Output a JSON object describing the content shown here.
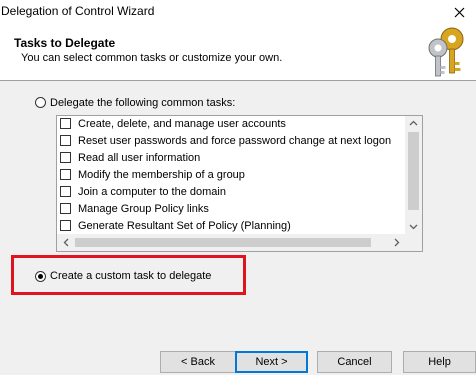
{
  "window": {
    "title": "Delegation of Control Wizard",
    "close_glyph": "✕"
  },
  "header": {
    "title": "Tasks to Delegate",
    "subtitle": "You can select common tasks or customize your own.",
    "icon": "keys-icon"
  },
  "options": {
    "common_tasks_label": "Delegate the following common tasks:",
    "common_tasks_selected": false,
    "custom_task_label": "Create a custom task to delegate",
    "custom_task_selected": true
  },
  "tasks": [
    {
      "label": "Create, delete, and manage user accounts",
      "checked": false
    },
    {
      "label": "Reset user passwords and force password change at next logon",
      "checked": false
    },
    {
      "label": "Read all user information",
      "checked": false
    },
    {
      "label": "Modify the membership of a group",
      "checked": false
    },
    {
      "label": "Join a computer to the domain",
      "checked": false
    },
    {
      "label": "Manage Group Policy links",
      "checked": false
    },
    {
      "label": "Generate Resultant Set of Policy (Planning)",
      "checked": false
    }
  ],
  "buttons": {
    "back": "< Back",
    "next": "Next >",
    "cancel": "Cancel",
    "help": "Help"
  },
  "colors": {
    "highlight": "#e0141e",
    "default_button_border": "#0078d7"
  }
}
